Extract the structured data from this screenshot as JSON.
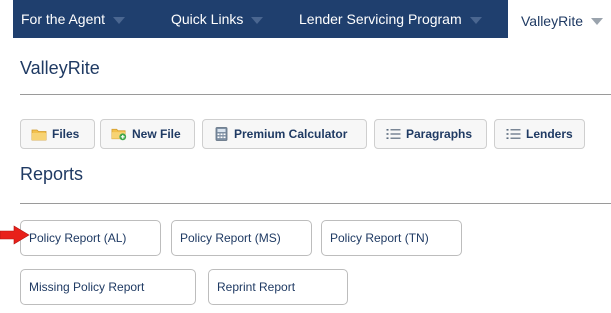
{
  "nav": {
    "items": [
      {
        "label": "For the Agent"
      },
      {
        "label": "Quick Links"
      },
      {
        "label": "Lender Servicing Program"
      }
    ],
    "active": {
      "label": "ValleyRite"
    }
  },
  "header": {
    "title": "ValleyRite"
  },
  "toolbar": {
    "files_label": "Files",
    "new_file_label": "New File",
    "premium_calculator_label": "Premium Calculator",
    "paragraphs_label": "Paragraphs",
    "lenders_label": "Lenders"
  },
  "reports": {
    "title": "Reports",
    "buttons": [
      {
        "label": "Policy Report (AL)"
      },
      {
        "label": "Policy Report (MS)"
      },
      {
        "label": "Policy Report (TN)"
      },
      {
        "label": "Missing Policy Report"
      },
      {
        "label": "Reprint Report"
      }
    ]
  },
  "colors": {
    "nav_bg": "#1f3f6e",
    "text": "#1f3a63",
    "pointer_arrow": "#e8201a"
  }
}
